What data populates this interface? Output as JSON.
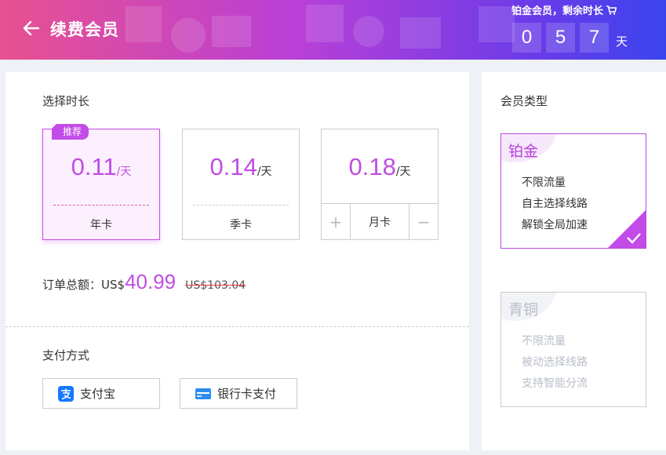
{
  "header": {
    "title": "续费会员",
    "member_status": "铂金会员，剩余时长",
    "countdown": [
      "0",
      "5",
      "7"
    ],
    "countdown_unit": "天"
  },
  "duration": {
    "label": "选择时长",
    "plans": [
      {
        "price": "0.11",
        "unit": "/天",
        "name": "年卡",
        "tag": "推荐",
        "selected": true
      },
      {
        "price": "0.14",
        "unit": "/天",
        "name": "季卡",
        "selected": false
      },
      {
        "price": "0.18",
        "unit": "/天",
        "name": "月卡",
        "selected": false,
        "stepper": {
          "minus": "+",
          "plus": "−"
        }
      }
    ]
  },
  "order": {
    "label": "订单总额：",
    "currency": "US$",
    "amount": "40.99",
    "original": "US$103.04"
  },
  "payment": {
    "label": "支付方式",
    "methods": [
      {
        "label": "支付宝",
        "icon": "alipay-icon"
      },
      {
        "label": "银行卡支付",
        "icon": "bank-card-icon"
      }
    ]
  },
  "member_types": {
    "label": "会员类型",
    "types": [
      {
        "title": "铂金",
        "features": [
          "不限流量",
          "自主选择线路",
          "解锁全局加速"
        ],
        "selected": true
      },
      {
        "title": "青铜",
        "features": [
          "不限流量",
          "被动选择线路",
          "支持智能分流"
        ],
        "selected": false
      }
    ]
  },
  "colors": {
    "accent": "#c34be8",
    "header_gradient": [
      "#e8518f",
      "#b83fd8",
      "#3b44ee"
    ],
    "strike": "#e0373b"
  }
}
